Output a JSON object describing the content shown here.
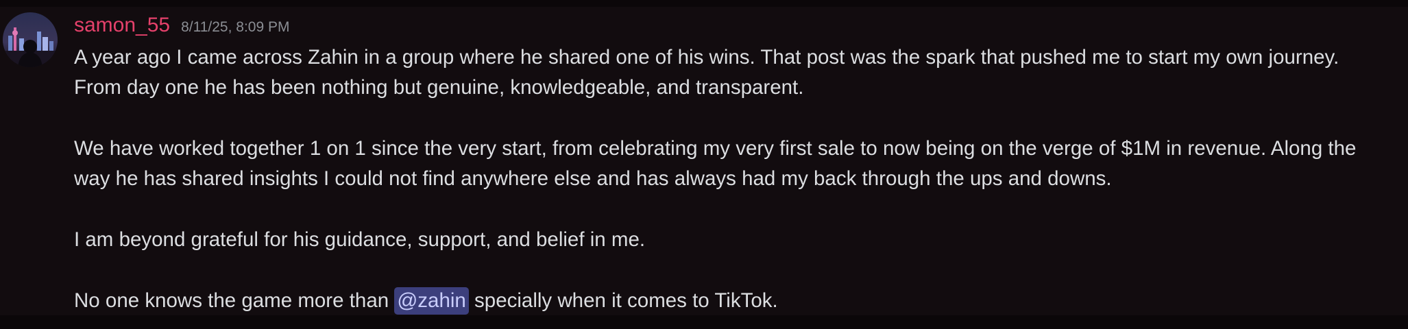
{
  "message": {
    "username": "samon_55",
    "timestamp": "8/11/25, 8:09 PM",
    "username_color": "#e5416b",
    "paragraphs": {
      "p1_line1": "A year ago I came across Zahin in a group where he shared one of his wins. That post was the spark that pushed me to start my own journey.",
      "p1_line2": "From day one he has been nothing but genuine, knowledgeable, and transparent.",
      "p2_line1": "We have worked together 1 on 1 since the very start, from celebrating my very first sale to now being on the verge of $1M in revenue. Along the",
      "p2_line2": "way he has shared insights I could not find anywhere else and has always had my back through the ups and downs.",
      "p3": "I am beyond grateful for his guidance, support, and belief in me.",
      "p4_before": "No one knows the game more than ",
      "p4_mention": "@zahin",
      "p4_after": " specially when it comes to TikTok."
    }
  },
  "colors": {
    "background": "#120c0f",
    "text": "#dcdee1",
    "timestamp": "#8b8e94",
    "mention_bg": "#3c3f7c",
    "mention_text": "#c9cdfb"
  }
}
